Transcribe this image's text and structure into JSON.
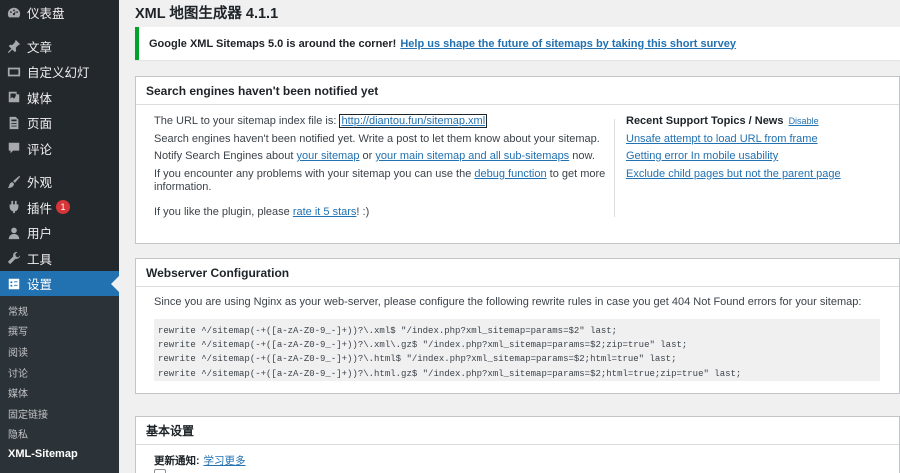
{
  "sidebar": {
    "items": [
      {
        "label": "仪表盘",
        "icon": "dashboard-icon"
      },
      {
        "label": "文章",
        "icon": "pushpin-icon"
      },
      {
        "label": "自定义幻灯",
        "icon": "slides-icon"
      },
      {
        "label": "媒体",
        "icon": "media-icon"
      },
      {
        "label": "页面",
        "icon": "page-icon"
      },
      {
        "label": "评论",
        "icon": "comment-icon"
      },
      {
        "label": "外观",
        "icon": "brush-icon"
      },
      {
        "label": "插件",
        "icon": "plugin-icon",
        "badge": "1"
      },
      {
        "label": "用户",
        "icon": "user-icon"
      },
      {
        "label": "工具",
        "icon": "wrench-icon"
      },
      {
        "label": "设置",
        "icon": "settings-icon"
      }
    ],
    "submenu": [
      "常规",
      "撰写",
      "阅读",
      "讨论",
      "媒体",
      "固定链接",
      "隐私",
      "XML-Sitemap"
    ]
  },
  "page": {
    "title": "XML 地图生成器 4.1.1"
  },
  "notice": {
    "text": "Google XML Sitemaps 5.0 is around the corner!",
    "link": "Help us shape the future of sitemaps by taking this short survey"
  },
  "box1": {
    "title": "Search engines haven't been notified yet",
    "url_prefix": "The URL to your sitemap index file is:",
    "url": "http://diantou.fun/sitemap.xml",
    "not_notified": "Search engines haven't been notified yet. Write a post to let them know about your sitemap.",
    "notify_prefix": "Notify Search Engines about",
    "notify_link1": "your sitemap",
    "notify_or": "or",
    "notify_link2": "your main sitemap and all sub-sitemaps",
    "notify_suffix": "now.",
    "problems_prefix": "If you encounter any problems with your sitemap you can use the",
    "problems_link": "debug function",
    "problems_suffix": "to get more information.",
    "rate_prefix": "If you like the plugin, please",
    "rate_link": "rate it 5 stars",
    "rate_suffix": "! :)",
    "support_title": "Recent Support Topics / News",
    "disable": "Disable",
    "support_links": [
      "Unsafe attempt to load URL from frame",
      "Getting error In mobile usability",
      "Exclude child pages but not the parent page"
    ]
  },
  "box2": {
    "title": "Webserver Configuration",
    "text": "Since you are using Nginx as your web-server, please configure the following rewrite rules in case you get 404 Not Found errors for your sitemap:",
    "code": [
      "rewrite ^/sitemap(-+([a-zA-Z0-9_-]+))?\\.xml$ \"/index.php?xml_sitemap=params=$2\" last;",
      "rewrite ^/sitemap(-+([a-zA-Z0-9_-]+))?\\.xml\\.gz$ \"/index.php?xml_sitemap=params=$2;zip=true\" last;",
      "rewrite ^/sitemap(-+([a-zA-Z0-9_-]+))?\\.html$ \"/index.php?xml_sitemap=params=$2;html=true\" last;",
      "rewrite ^/sitemap(-+([a-zA-Z0-9_-]+))?\\.html.gz$ \"/index.php?xml_sitemap=params=$2;html=true;zip=true\" last;"
    ]
  },
  "box3": {
    "title": "基本设置",
    "label": "更新通知:",
    "link": "学习更多"
  },
  "colors": {
    "accent": "#2271b1",
    "sidebar": "#23282d",
    "notice_border": "#00a32a",
    "badge": "#d63638"
  }
}
